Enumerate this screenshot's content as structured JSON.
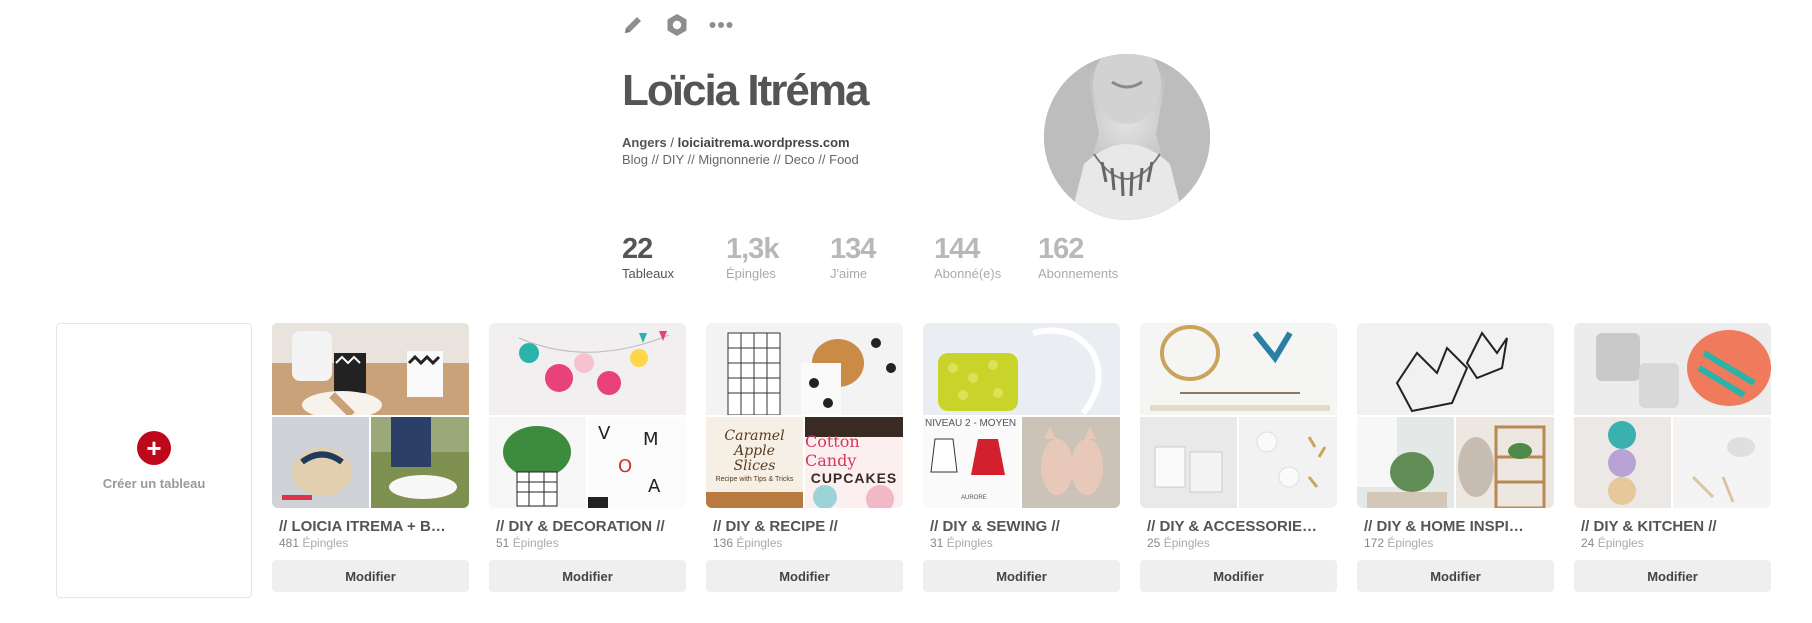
{
  "toolbar": {
    "edit_icon": "pencil-icon",
    "settings_icon": "hexagon-gear-icon",
    "more_icon": "more-dots-icon"
  },
  "profile": {
    "name": "Loïcia Itréma",
    "city": "Angers",
    "separator": " / ",
    "website": "loiciaitrema.wordpress.com",
    "bio": "Blog // DIY // Mignonnerie // Deco // Food"
  },
  "stats": [
    {
      "value": "22",
      "label": "Tableaux"
    },
    {
      "value": "1,3k",
      "label": "Épingles"
    },
    {
      "value": "134",
      "label": "J'aime"
    },
    {
      "value": "144",
      "label": "Abonné(e)s"
    },
    {
      "value": "162",
      "label": "Abonnements"
    }
  ],
  "create_board": {
    "label": "Créer un tableau",
    "icon": "plus-icon"
  },
  "boards": [
    {
      "title": "// LOICIA ITREMA + B…",
      "count": "481",
      "count_label": " Épingles",
      "edit_label": "Modifier"
    },
    {
      "title": "// DIY & DECORATION //",
      "count": "51",
      "count_label": " Épingles",
      "edit_label": "Modifier"
    },
    {
      "title": "// DIY & RECIPE //",
      "count": "136",
      "count_label": " Épingles",
      "edit_label": "Modifier",
      "cover_texts": [
        "Caramel Apple Slices",
        "Recipe with Tips & Tricks",
        "Cotton Candy",
        "CUPCAKES"
      ]
    },
    {
      "title": "// DIY & SEWING //",
      "count": "31",
      "count_label": " Épingles",
      "edit_label": "Modifier",
      "cover_texts": [
        "NIVEAU 2 - MOYEN",
        "AURORE"
      ]
    },
    {
      "title": "// DIY & ACCESSORIE…",
      "count": "25",
      "count_label": " Épingles",
      "edit_label": "Modifier"
    },
    {
      "title": "// DIY & HOME INSPI…",
      "count": "172",
      "count_label": " Épingles",
      "edit_label": "Modifier"
    },
    {
      "title": "// DIY & KITCHEN //",
      "count": "24",
      "count_label": " Épingles",
      "edit_label": "Modifier"
    }
  ],
  "colors": {
    "accent": "#bd081c",
    "button_bg": "#efefef",
    "text": "#555555",
    "muted": "#aaaaaa"
  }
}
